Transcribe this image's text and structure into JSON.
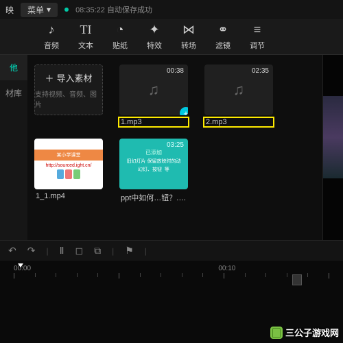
{
  "header": {
    "menu_label": "菜单",
    "status_time": "08:35:22",
    "status_text": "自动保存成功"
  },
  "tools": [
    {
      "label": "",
      "icon": ""
    },
    {
      "label": "音频",
      "icon": "music"
    },
    {
      "label": "文本",
      "icon": "text"
    },
    {
      "label": "贴纸",
      "icon": "clock"
    },
    {
      "label": "特效",
      "icon": "star"
    },
    {
      "label": "转场",
      "icon": "bowtie"
    },
    {
      "label": "滤镜",
      "icon": "venn"
    },
    {
      "label": "调节",
      "icon": "sliders"
    }
  ],
  "sidebar": {
    "tabs": [
      "他",
      "材库"
    ]
  },
  "import": {
    "title": "导入素材",
    "subtitle": "支持视频、音频、图片"
  },
  "media": [
    {
      "kind": "audio",
      "duration": "00:38",
      "caption": "1.mp3",
      "highlight": true,
      "add": true
    },
    {
      "kind": "audio",
      "duration": "02:35",
      "caption": "2.mp3",
      "highlight": true,
      "add": false
    },
    {
      "kind": "video1",
      "duration": "",
      "caption": "1_1.mp4",
      "highlight": false
    },
    {
      "kind": "video2",
      "duration": "03:25",
      "tag": "已添加",
      "caption": "ppt中如何…钮？.mp4",
      "highlight": false
    }
  ],
  "ruler": {
    "labels": [
      "00:00",
      "",
      "00:10",
      ""
    ]
  },
  "watermark": "三公子游戏网"
}
